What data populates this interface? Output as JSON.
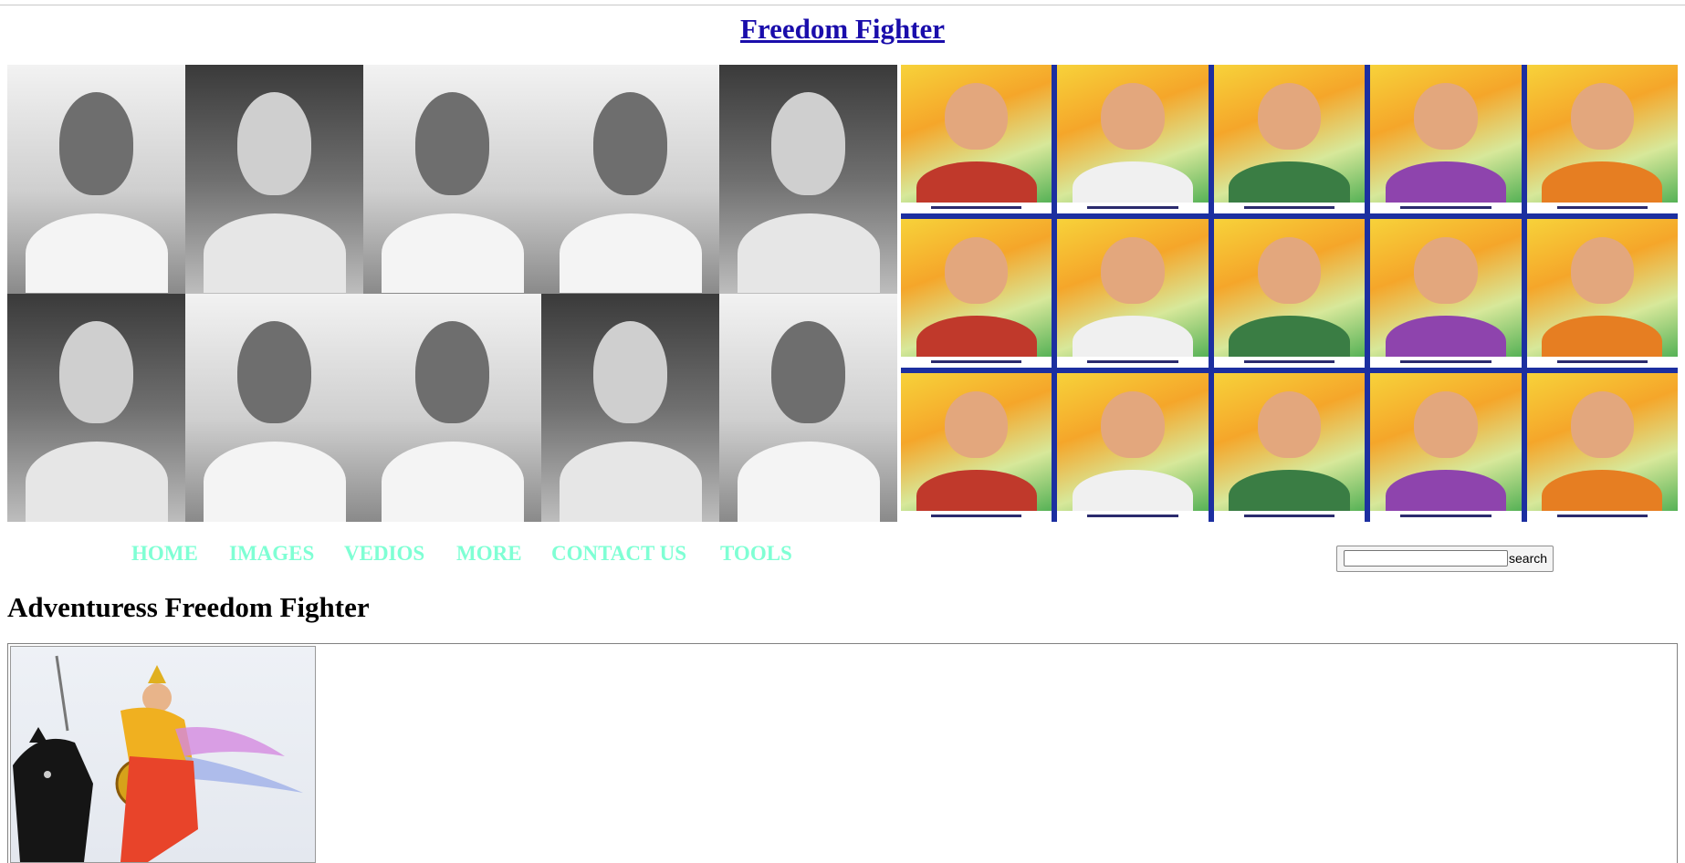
{
  "page": {
    "title": "Freedom Fighter"
  },
  "banner": {
    "left_grid": {
      "rows": 2,
      "cols": 5,
      "style": "black-and-white portraits"
    },
    "right_grid": {
      "rows": 3,
      "cols": 5,
      "style": "colored portraits with name captions"
    }
  },
  "nav": {
    "items": [
      "HOME",
      "IMAGES",
      "VEDIOS",
      "MORE",
      "CONTACT US",
      "TOOLS"
    ],
    "color": "#7fffd4"
  },
  "search": {
    "value": "",
    "placeholder": "",
    "button_label": "search"
  },
  "section": {
    "heading": "Adventuress Freedom Fighter"
  },
  "colors": {
    "title_link": "#1a0dab",
    "background": "#ffffff",
    "banner_frame": "#1c2fa0"
  }
}
